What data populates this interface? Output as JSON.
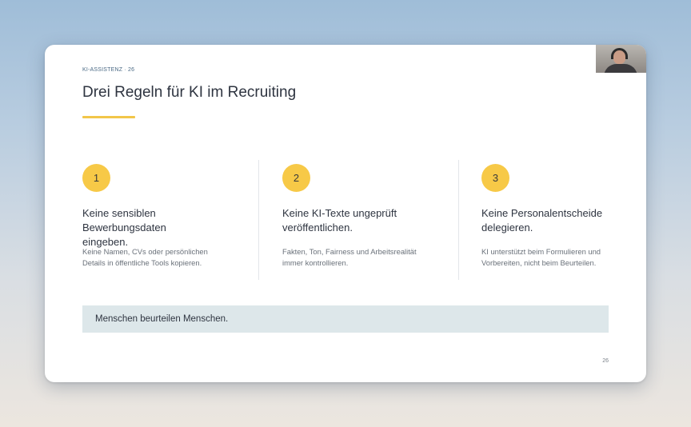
{
  "slide": {
    "kicker": "KI-ASSISTENZ · 26",
    "title": "Drei Regeln für KI im Recruiting",
    "page_number": "26",
    "accent_color": "#f7c947",
    "rules": [
      {
        "number": "1",
        "heading": "Keine sensiblen Bewerbungsdaten eingeben.",
        "text": "Keine Namen, CVs oder persönlichen Details in öffentliche Tools kopieren."
      },
      {
        "number": "2",
        "heading": "Keine KI-Texte ungeprüft veröffentlichen.",
        "text": "Fakten, Ton, Fairness und Arbeitsrealität immer kontrollieren."
      },
      {
        "number": "3",
        "heading": "Keine Personalentscheide delegieren.",
        "text": "KI unterstützt beim Formulieren und Vorbereiten, nicht beim Beurteilen."
      }
    ],
    "callout": "Menschen beurteilen Menschen."
  }
}
